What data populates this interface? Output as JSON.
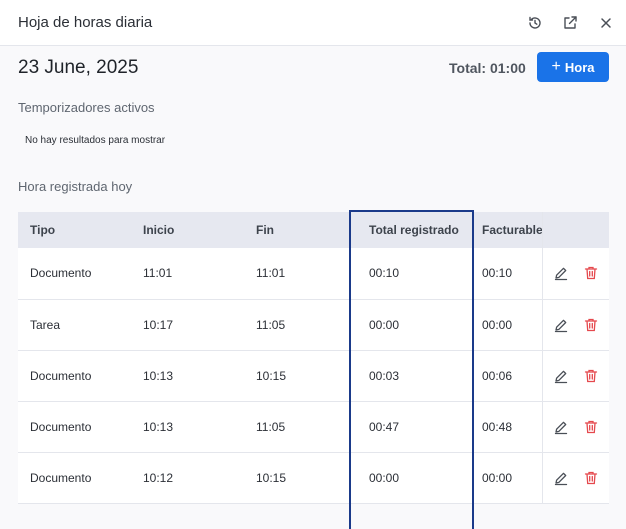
{
  "header": {
    "title": "Hoja de horas diaria",
    "icons": [
      "history-icon",
      "open-external-icon",
      "close-icon"
    ]
  },
  "summary": {
    "date": "23 June, 2025",
    "total": "Total: 01:00",
    "add_button": {
      "plus": "+",
      "label": "Hora"
    }
  },
  "active_timers": {
    "label": "Temporizadores activos",
    "empty_text": "No hay resultados para mostrar"
  },
  "today": {
    "label": "Hora registrada hoy",
    "columns": [
      "Tipo",
      "Inicio",
      "Fin",
      "Total registrado",
      "Facturable"
    ],
    "rows": [
      {
        "tipo": "Documento",
        "inicio": "11:01",
        "fin": "11:01",
        "total": "00:10",
        "facturable": "00:10"
      },
      {
        "tipo": "Tarea",
        "inicio": "10:17",
        "fin": "11:05",
        "total": "00:00",
        "facturable": "00:00"
      },
      {
        "tipo": "Documento",
        "inicio": "10:13",
        "fin": "10:15",
        "total": "00:03",
        "facturable": "00:06"
      },
      {
        "tipo": "Documento",
        "inicio": "10:13",
        "fin": "11:05",
        "total": "00:47",
        "facturable": "00:48"
      },
      {
        "tipo": "Documento",
        "inicio": "10:12",
        "fin": "10:15",
        "total": "00:00",
        "facturable": "00:00"
      }
    ]
  },
  "colors": {
    "accent": "#1a73e8",
    "delete": "#e5484d",
    "highlight_border": "#1a3a8a",
    "table_header_bg": "#e6e8f0"
  }
}
